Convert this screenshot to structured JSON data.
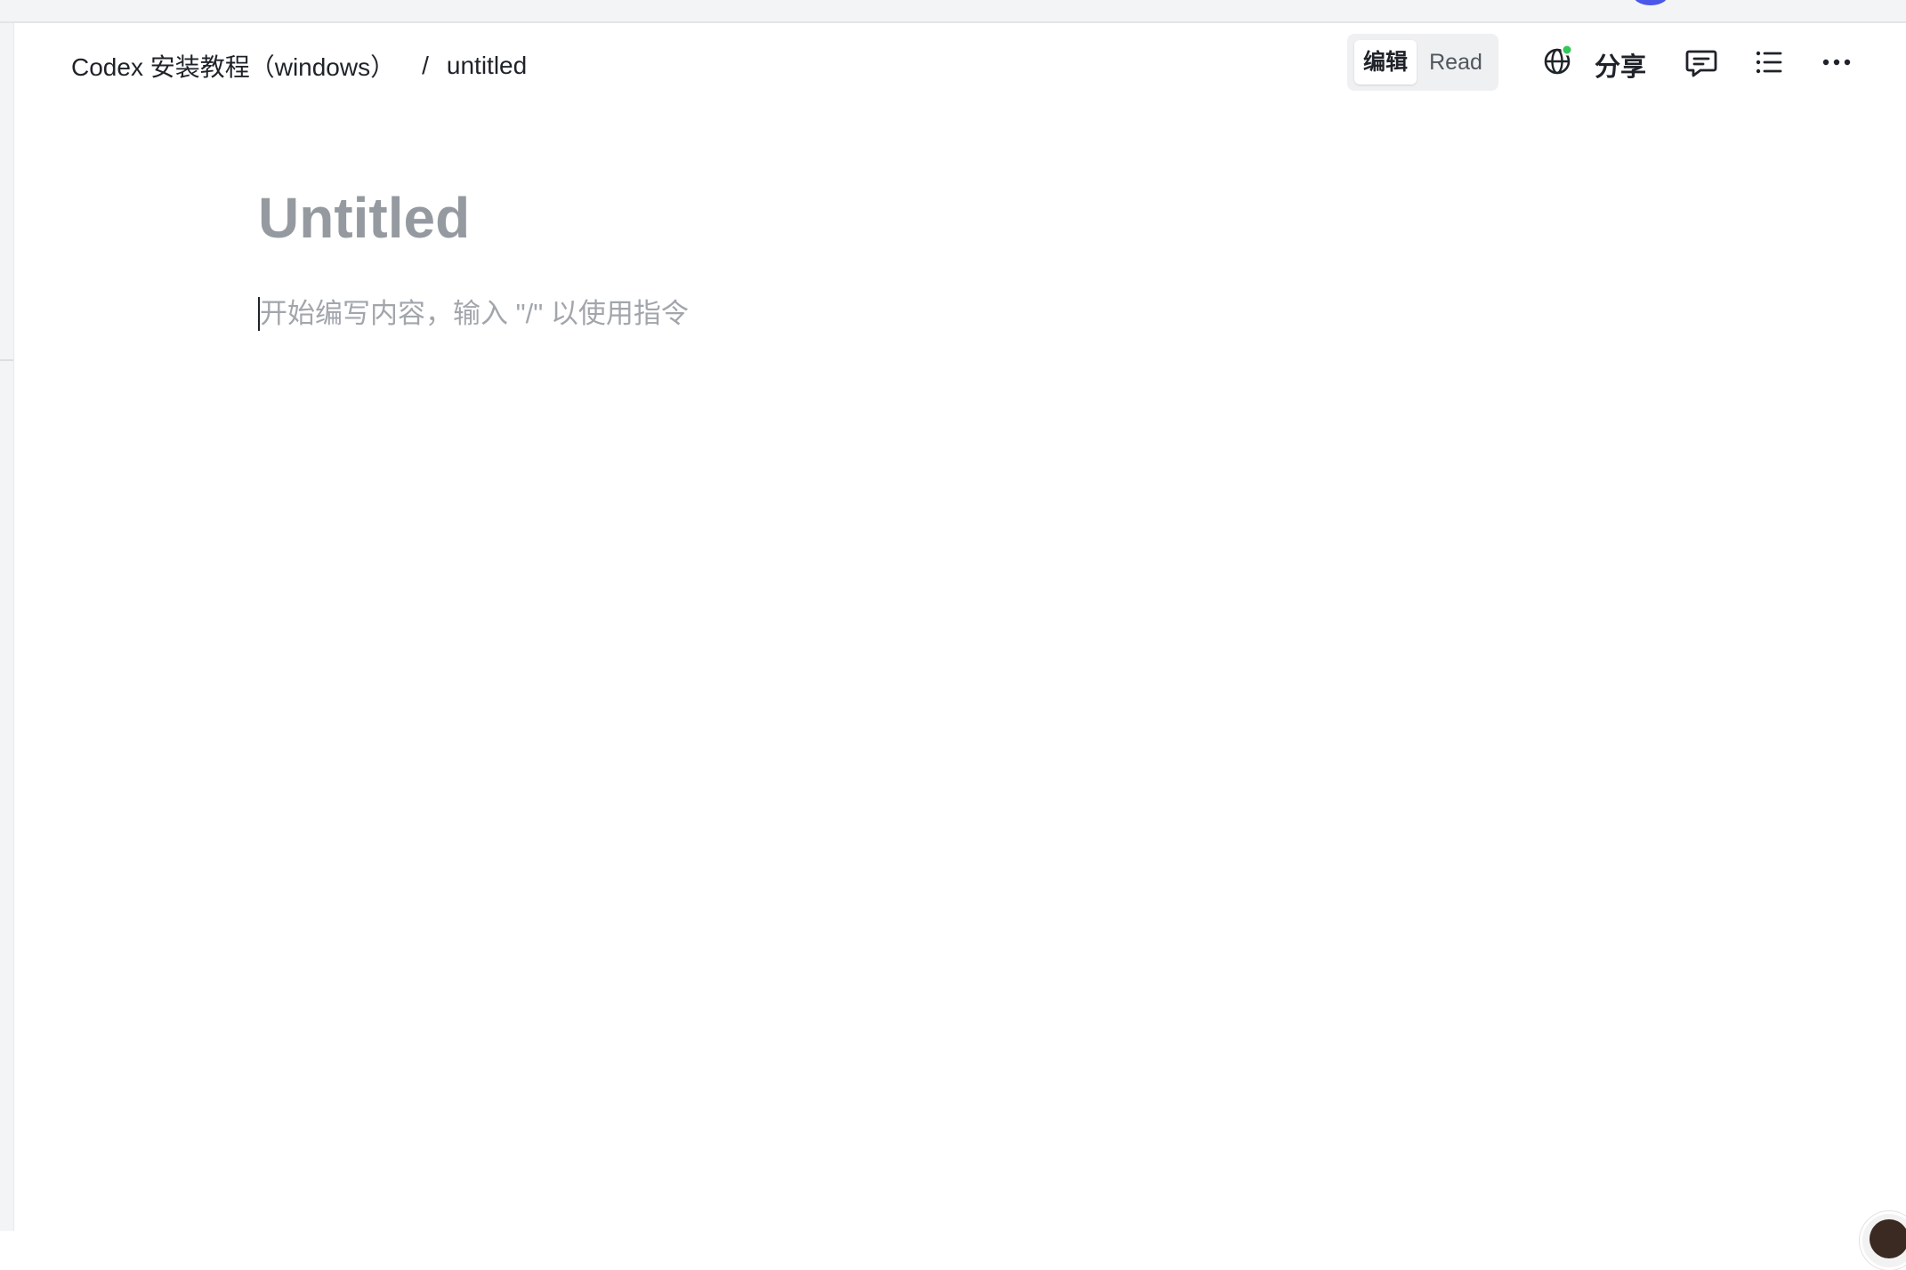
{
  "breadcrumb": {
    "parent": "Codex 安装教程（windows）",
    "separator": "/",
    "current": "untitled"
  },
  "mode_toggle": {
    "edit_label": "编辑",
    "read_label": "Read",
    "active": "edit"
  },
  "toolbar": {
    "share_label": "分享",
    "globe_icon": "globe-icon",
    "comment_icon": "comment-icon",
    "outline_icon": "list-icon",
    "more_icon": "more-icon",
    "online_status_color": "#34c759"
  },
  "document": {
    "title": "Untitled",
    "placeholder": "开始编写内容，输入 \"/\" 以使用指令"
  },
  "colors": {
    "accent": "#4a57e8",
    "title_placeholder": "#959aa1",
    "body_placeholder": "#a2a6ac",
    "text": "#1f2329"
  }
}
